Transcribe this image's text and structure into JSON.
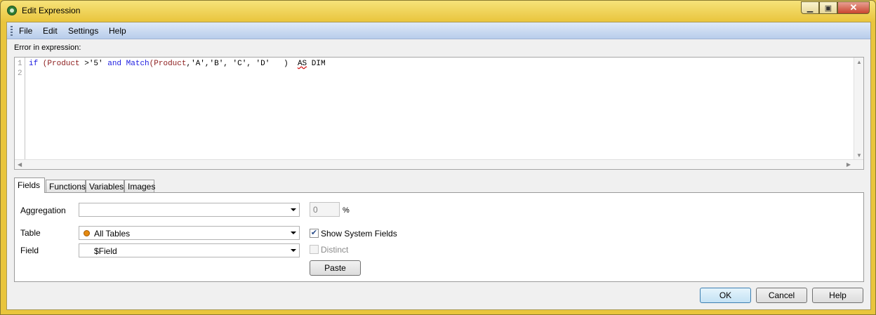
{
  "window": {
    "title": "Edit Expression"
  },
  "menu": {
    "items": [
      "File",
      "Edit",
      "Settings",
      "Help"
    ]
  },
  "editor": {
    "label": "Error in expression:",
    "line_numbers": [
      "1",
      "2"
    ],
    "line1": {
      "if": "if",
      "open": " (",
      "product1": "Product",
      "cmp": " >'5' ",
      "and": "and",
      "sp": " ",
      "match": "Match",
      "paren": "(",
      "product2": "Product",
      "args": ",'A','B', 'C', 'D'   )  ",
      "as": "AS",
      "dim": " DIM"
    }
  },
  "tabs": [
    "Fields",
    "Functions",
    "Variables",
    "Images"
  ],
  "fields_panel": {
    "aggregation_label": "Aggregation",
    "aggregation_value": "",
    "percent_value": "0",
    "percent_sign": "%",
    "table_label": "Table",
    "table_value": "All Tables",
    "field_label": "Field",
    "field_value": "$Field",
    "show_system_fields_label": "Show System Fields",
    "show_system_fields_checked": true,
    "distinct_label": "Distinct",
    "distinct_checked": false,
    "paste_label": "Paste"
  },
  "buttons": {
    "ok": "OK",
    "cancel": "Cancel",
    "help": "Help"
  },
  "colors": {
    "title_bar": "#e9c53c",
    "menubar": "#c8d9f0",
    "keyword": "#1c1ce0",
    "field_name": "#8b1a1a"
  }
}
